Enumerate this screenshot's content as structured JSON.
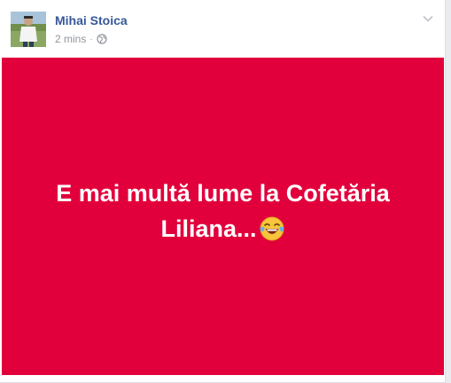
{
  "post": {
    "author_name": "Mihai Stoica",
    "timestamp": "2 mins",
    "separator": "·",
    "privacy_icon": "globe-icon",
    "menu_icon": "chevron-down-icon",
    "body": {
      "text": "E mai multă lume la Cofetăria Liliana...",
      "emoji": "laughing-tears-emoji",
      "background_color": "#e2003c",
      "text_color": "#ffffff"
    }
  },
  "colors": {
    "author_link": "#365899",
    "meta_text": "#90949c",
    "page_background": "#e9ebee"
  }
}
